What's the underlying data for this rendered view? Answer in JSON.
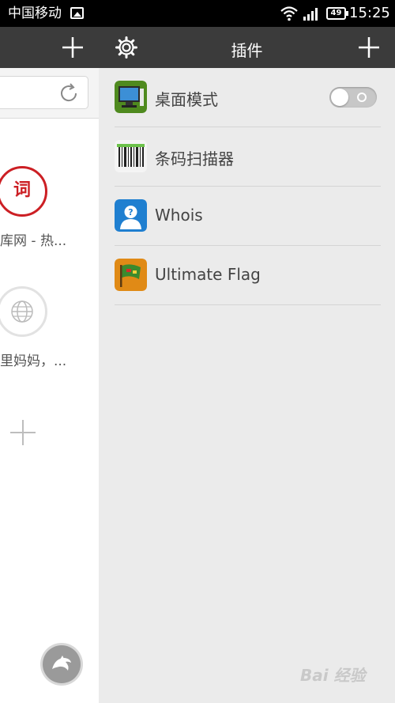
{
  "status_bar": {
    "carrier": "中国移动",
    "battery": "49",
    "time": "15:25"
  },
  "browser": {
    "speed_dial": [
      {
        "icon_text": "词",
        "label": "库网 - 热..."
      },
      {
        "icon_text": "",
        "label": "里妈妈，..."
      }
    ]
  },
  "plugins_panel": {
    "title": "插件",
    "items": [
      {
        "name": "桌面模式",
        "icon": "desktop-mode-icon",
        "has_toggle": true,
        "toggle_on": false
      },
      {
        "name": "条码扫描器",
        "icon": "barcode-scanner-icon"
      },
      {
        "name": "Whois",
        "icon": "whois-icon"
      },
      {
        "name": "Ultimate Flag",
        "icon": "ultimate-flag-icon"
      }
    ]
  },
  "watermark": "Bai 经验",
  "colors": {
    "header_bg": "#3b3b3b",
    "panel_bg": "#ebebeb",
    "dial_red": "#cc1f24"
  }
}
